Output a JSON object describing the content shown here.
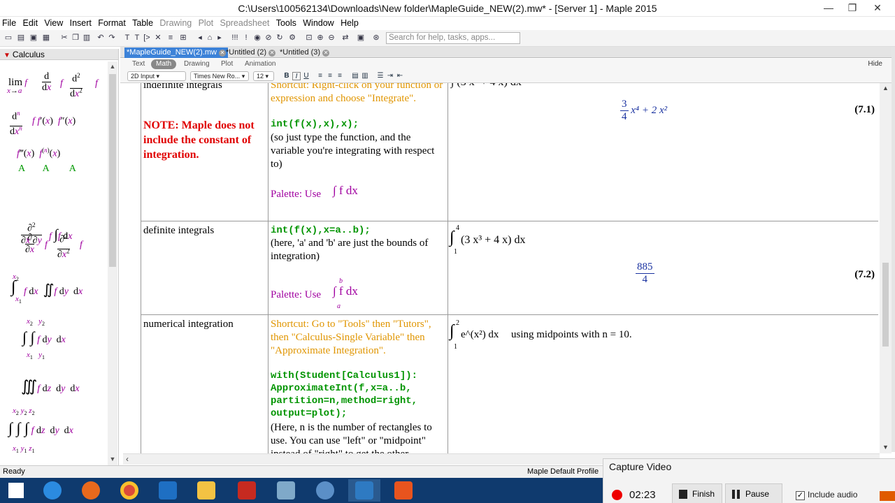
{
  "window": {
    "title": "C:\\Users\\100562134\\Downloads\\New folder\\MapleGuide_NEW(2).mw* - [Server 1] - Maple 2015",
    "min_glyph": "—",
    "max_glyph": "❐",
    "close_glyph": "✕"
  },
  "menu": [
    {
      "label": "File",
      "dim": false
    },
    {
      "label": "Edit",
      "dim": false
    },
    {
      "label": "View",
      "dim": false
    },
    {
      "label": "Insert",
      "dim": false
    },
    {
      "label": "Format",
      "dim": false
    },
    {
      "label": "Table",
      "dim": false
    },
    {
      "label": "Drawing",
      "dim": true
    },
    {
      "label": "Plot",
      "dim": true
    },
    {
      "label": "Spreadsheet",
      "dim": true
    },
    {
      "label": "Tools",
      "dim": false
    },
    {
      "label": "Window",
      "dim": false
    },
    {
      "label": "Help",
      "dim": false
    }
  ],
  "search": {
    "placeholder": "Search for help, tasks, apps..."
  },
  "palette": {
    "title": "Calculus",
    "scroll_up": "▲",
    "scroll_down": "▼"
  },
  "tabs": [
    {
      "label": "*MapleGuide_NEW(2).mw",
      "close": "✕"
    },
    {
      "label": "*Untitled (2)",
      "close": "✕"
    },
    {
      "label": "*Untitled (3)",
      "close": "✕"
    }
  ],
  "modes": {
    "text": "Text",
    "math": "Math",
    "drawing": "Drawing",
    "plot": "Plot",
    "animation": "Animation",
    "hide": "Hide"
  },
  "format": {
    "input_mode": "2D Input",
    "font": "Times New Ro...",
    "size": "12",
    "bold": "B",
    "italic": "I",
    "underline": "U"
  },
  "rows": [
    {
      "topic": "indefinite integrals",
      "note": "NOTE:  Maple does not include the constant of integration.",
      "shortcut": "Shortcut: Right-click on your function or expression and choose \"Integrate\".",
      "code": "int(f(x),x),x);",
      "desc": "(so just type the function, and the variable you're integrating with respect to)",
      "palette_text": "Palette: Use",
      "palette_math": "∫ f dx",
      "input_math": "∫ (3 x³ + 4 x) dx",
      "result_num": "3",
      "result_den": "4",
      "result_rest": "x⁴ + 2 x²",
      "label": "(7.1)"
    },
    {
      "topic": "definite integrals",
      "code": "int(f(x),x=a..b);",
      "desc": "(here, 'a' and 'b' are just the bounds of integration)",
      "palette_text": "Palette: Use",
      "palette_math": "∫ f dx",
      "palette_lower": "a",
      "palette_upper": "b",
      "input_math": "(3 x³ + 4 x) dx",
      "input_lower": "1",
      "input_upper": "4",
      "result_num": "885",
      "result_den": "4",
      "label": "(7.2)"
    },
    {
      "topic": "numerical integration",
      "shortcut": "Shortcut: Go to \"Tools\" then \"Tutors\", then \"Calculus-Single Variable\" then \"Approximate Integration\".",
      "code": "with(Student[Calculus1]):\nApproximateInt(f,x=a..b,\npartition=n,method=right,\noutput=plot);",
      "desc": "(Here, n is the number of rectangles to use.  You can use \"left\" or \"midpoint\" instead of \"right\" to get the other",
      "input_math": "e^(x²) dx",
      "input_lower": "1",
      "input_upper": "2",
      "input_tail": "using midpoints with n = 10."
    }
  ],
  "status": {
    "left": "Ready",
    "right": "Maple Default Profile"
  },
  "capture": {
    "title": "Capture Video",
    "time": "02:23",
    "finish": "Finish",
    "pause": "Pause",
    "include_audio": "Include audio"
  }
}
